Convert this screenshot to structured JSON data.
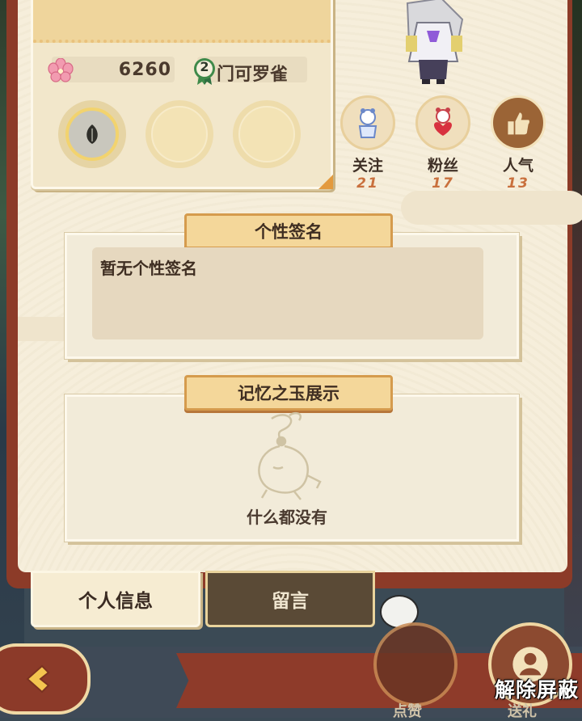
{
  "profile": {
    "score": "6260",
    "level": "2",
    "nickname": "门可罗雀"
  },
  "social": [
    {
      "label": "关注",
      "value": "21",
      "icon": "doll-icon"
    },
    {
      "label": "粉丝",
      "value": "17",
      "icon": "heart-doll-icon"
    },
    {
      "label": "人气",
      "value": "13",
      "icon": "thumbs-up-icon"
    }
  ],
  "signature": {
    "title": "个性签名",
    "text": "暂无个性签名"
  },
  "memory": {
    "title": "记忆之玉展示",
    "empty_text": "什么都没有"
  },
  "tabs": {
    "info": "个人信息",
    "message": "留言"
  },
  "bottom": {
    "like_label": "点赞",
    "gift_label": "送礼",
    "unblock_label": "解除屏蔽"
  },
  "colors": {
    "frame": "#8c3b28",
    "paper": "#f6eedb",
    "number_accent": "#c9703d"
  }
}
